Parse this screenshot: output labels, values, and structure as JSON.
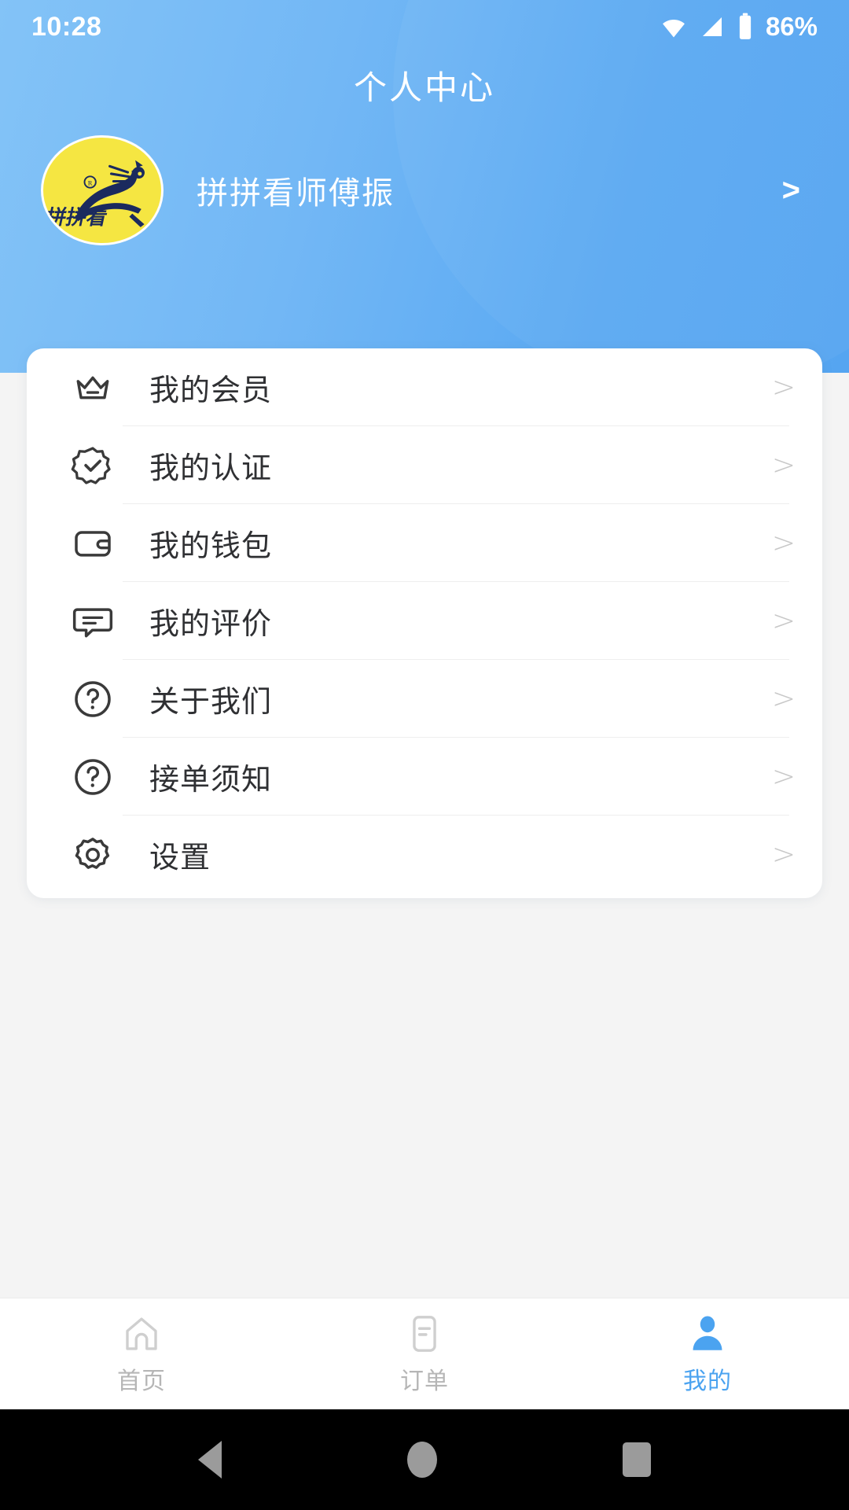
{
  "statusbar": {
    "time": "10:28",
    "battery_percent": "86%",
    "icons": [
      "wifi-icon",
      "cellular-signal-icon",
      "battery-icon"
    ]
  },
  "header": {
    "title": "个人中心",
    "gradient_from": "#83c3f7",
    "gradient_to": "#55a5f1",
    "profile": {
      "name": "拼拼看师傅振",
      "arrow": ">",
      "avatar_alt": "拼拼看",
      "avatar_bg": "#f5e642",
      "avatar_mark": "®"
    }
  },
  "menu": {
    "chevron": ">",
    "items": [
      {
        "label": "我的会员",
        "icon": "crown-icon"
      },
      {
        "label": "我的认证",
        "icon": "verified-badge-icon"
      },
      {
        "label": "我的钱包",
        "icon": "wallet-icon"
      },
      {
        "label": "我的评价",
        "icon": "comment-icon"
      },
      {
        "label": "关于我们",
        "icon": "question-circle-icon"
      },
      {
        "label": "接单须知",
        "icon": "question-circle-icon"
      },
      {
        "label": "设置",
        "icon": "gear-icon"
      }
    ]
  },
  "tabbar": {
    "active_color": "#4ba3f0",
    "inactive_color": "#b6b6b6",
    "tabs": [
      {
        "label": "首页",
        "icon": "home-icon",
        "active": false
      },
      {
        "label": "订单",
        "icon": "order-document-icon",
        "active": false
      },
      {
        "label": "我的",
        "icon": "person-icon",
        "active": true
      }
    ]
  },
  "navbar": {
    "buttons": [
      "back-button",
      "home-button",
      "recents-button"
    ]
  }
}
